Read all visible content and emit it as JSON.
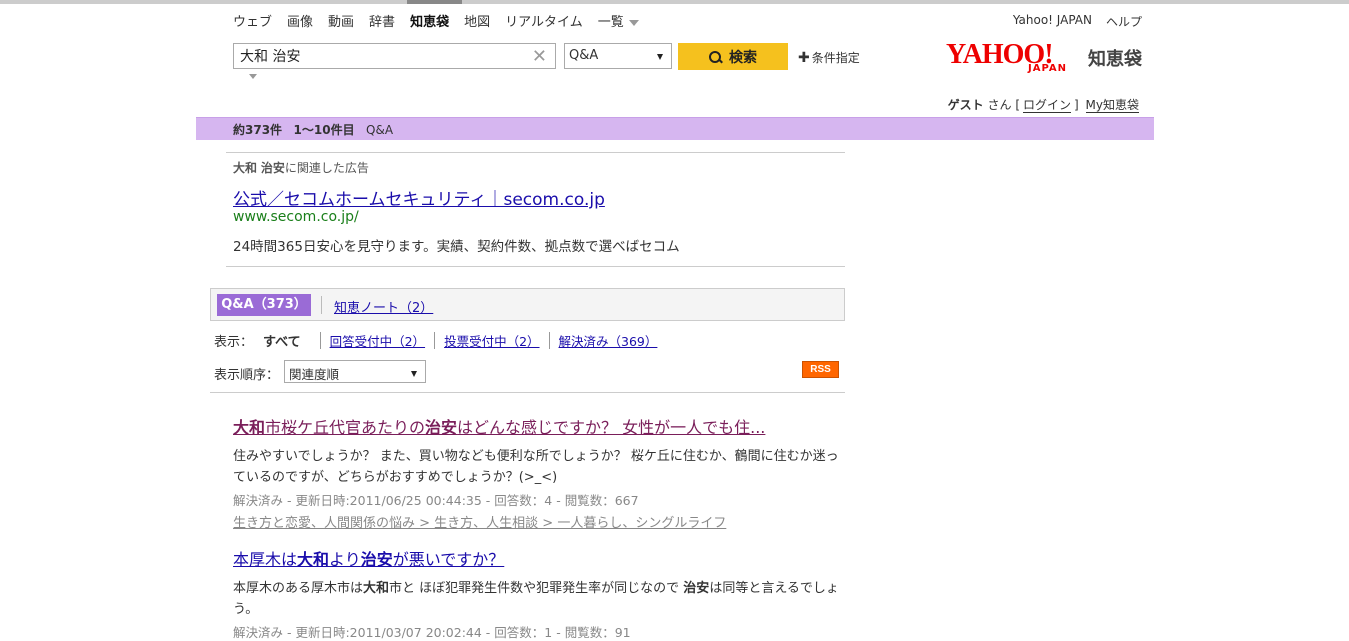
{
  "nav": {
    "items": [
      "ウェブ",
      "画像",
      "動画",
      "辞書",
      "知恵袋",
      "地図",
      "リアルタイム",
      "一覧"
    ],
    "active": "知恵袋"
  },
  "toplinks": {
    "yahoo": "Yahoo! JAPAN",
    "help": "ヘルプ"
  },
  "search": {
    "query": "大和 治安",
    "category": "Q&A",
    "button": "検索",
    "conditions": "条件指定"
  },
  "logo": {
    "yahoo": "YAHOO!",
    "japan": "JAPAN",
    "service": "知恵袋"
  },
  "user": {
    "name": "ゲスト",
    "suffix": "さん",
    "login": "ログイン",
    "my": "My知恵袋"
  },
  "resultbar": {
    "count": "約373件",
    "range": "1〜10件目",
    "type": "Q&A"
  },
  "ad": {
    "heading_kw1": "大和",
    "heading_kw2": "治安",
    "heading_rest": "に関連した広告",
    "title": "公式／セコムホームセキュリティ｜secom.co.jp",
    "url": "www.secom.co.jp/",
    "desc": "24時間365日安心を見守ります。実績、契約件数、拠点数で選べばセコム"
  },
  "tabs": {
    "qa": "Q&A（373）",
    "note": "知恵ノート（2）"
  },
  "filters": {
    "label": "表示：",
    "current": "すべて",
    "f1": "回答受付中（2）",
    "f2": "投票受付中（2）",
    "f3": "解決済み（369）"
  },
  "sort": {
    "label": "表示順序：",
    "value": "関連度順"
  },
  "rss": "RSS",
  "results": [
    {
      "title_parts": [
        "大和",
        "市桜ケ丘代官あたりの",
        "治安",
        "はどんな感じですか？ 女性が一人でも住..."
      ],
      "body": "住みやすいでしょうか？ また、買い物なども便利な所でしょうか？ 桜ケ丘に住むか、鶴間に住むか迷っているのですが、どちらがおすすめでしょうか？(>_<)",
      "meta": "解決済み - 更新日時:2011/06/25 00:44:35 - 回答数：4 - 閲覧数：667",
      "category": "生き方と恋愛、人間関係の悩み > 生き方、人生相談 > 一人暮らし、シングルライフ"
    },
    {
      "title_parts": [
        "本厚木は",
        "大和",
        "より",
        "治安",
        "が悪いですか？"
      ],
      "body_parts": [
        "本厚木のある厚木市は",
        "大和",
        "市と ほぼ犯罪発生件数や犯罪発生率が同じなので ",
        "治安",
        "は同等と言えるでしょう。"
      ],
      "meta": "解決済み - 更新日時:2011/03/07 20:02:44 - 回答数：1 - 閲覧数：91"
    }
  ]
}
